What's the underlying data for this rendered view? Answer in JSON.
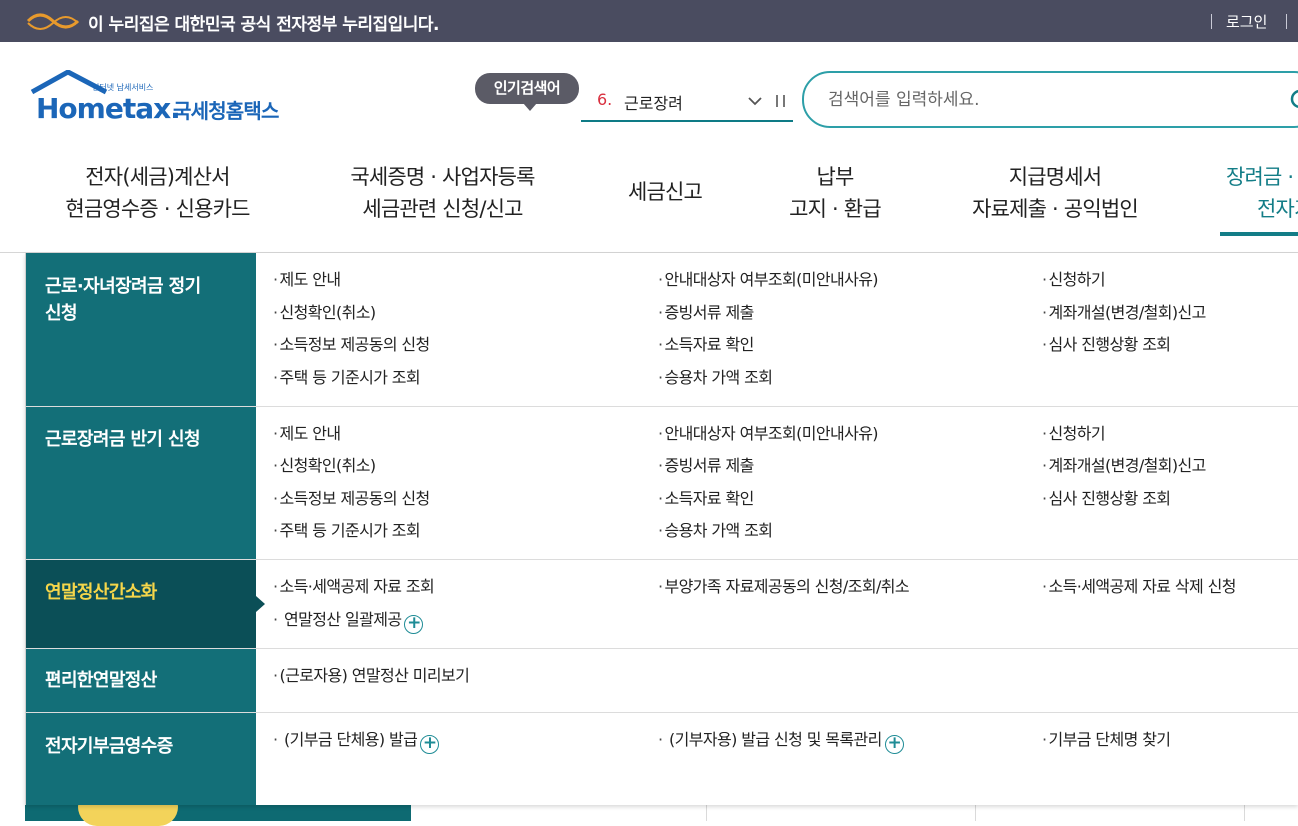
{
  "gov_banner": {
    "text": "이 누리집은 대한민국 공식 전자정부 누리집입니다.",
    "login": "로그인"
  },
  "logo": {
    "tagline": "인터넷 납세서비스",
    "brand": "Hometax.",
    "name": "국세청홈택스"
  },
  "popular": {
    "badge": "인기검색어",
    "rank": "6.",
    "keyword": "근로장려"
  },
  "search": {
    "placeholder": "검색어를 입력하세요."
  },
  "nav": [
    {
      "line1": "전자(세금)계산서",
      "line2": "현금영수증 · 신용카드"
    },
    {
      "line1": "국세증명 · 사업자등록",
      "line2": "세금관련 신청/신고"
    },
    {
      "line1": "세금신고",
      "line2": ""
    },
    {
      "line1": "납부",
      "line2": "고지 · 환급"
    },
    {
      "line1": "지급명세서",
      "line2": "자료제출 · 공익법인"
    },
    {
      "line1": "장려금 · 연말정산",
      "line2": "전자기부금"
    }
  ],
  "menu": [
    {
      "title": "근로·자녀장려금 정기신청",
      "links": [
        "제도 안내",
        "안내대상자 여부조회(미안내사유)",
        "신청하기",
        "신청확인(취소)",
        "증빙서류 제출",
        "계좌개설(변경/철회)신고",
        "소득정보 제공동의 신청",
        "소득자료 확인",
        "심사 진행상황 조회",
        "주택 등 기준시가 조회",
        "승용차 가액 조회"
      ]
    },
    {
      "title": "근로장려금 반기 신청",
      "links": [
        "제도 안내",
        "안내대상자 여부조회(미안내사유)",
        "신청하기",
        "신청확인(취소)",
        "증빙서류 제출",
        "계좌개설(변경/철회)신고",
        "소득정보 제공동의 신청",
        "소득자료 확인",
        "심사 진행상황 조회",
        "주택 등 기준시가 조회",
        "승용차 가액 조회"
      ]
    },
    {
      "title": "연말정산간소화",
      "selected": true,
      "links": [
        "소득·세액공제 자료 조회",
        "부양가족 자료제공동의 신청/조회/취소",
        "소득·세액공제 자료 삭제 신청",
        "연말정산 일괄제공"
      ]
    },
    {
      "title": "편리한연말정산",
      "links": [
        "(근로자용) 연말정산 미리보기"
      ]
    },
    {
      "title": "전자기부금영수증",
      "links": [
        "(기부금 단체용) 발급",
        "(기부자용) 발급 신청 및 목록관리",
        "기부금 단체명 찾기"
      ]
    }
  ],
  "colors": {
    "banner": "#4a4c60",
    "teal": "#136f78",
    "teal_selected": "#0b4f57",
    "selected_text": "#f5d64a",
    "rank_red": "#d9303f"
  }
}
